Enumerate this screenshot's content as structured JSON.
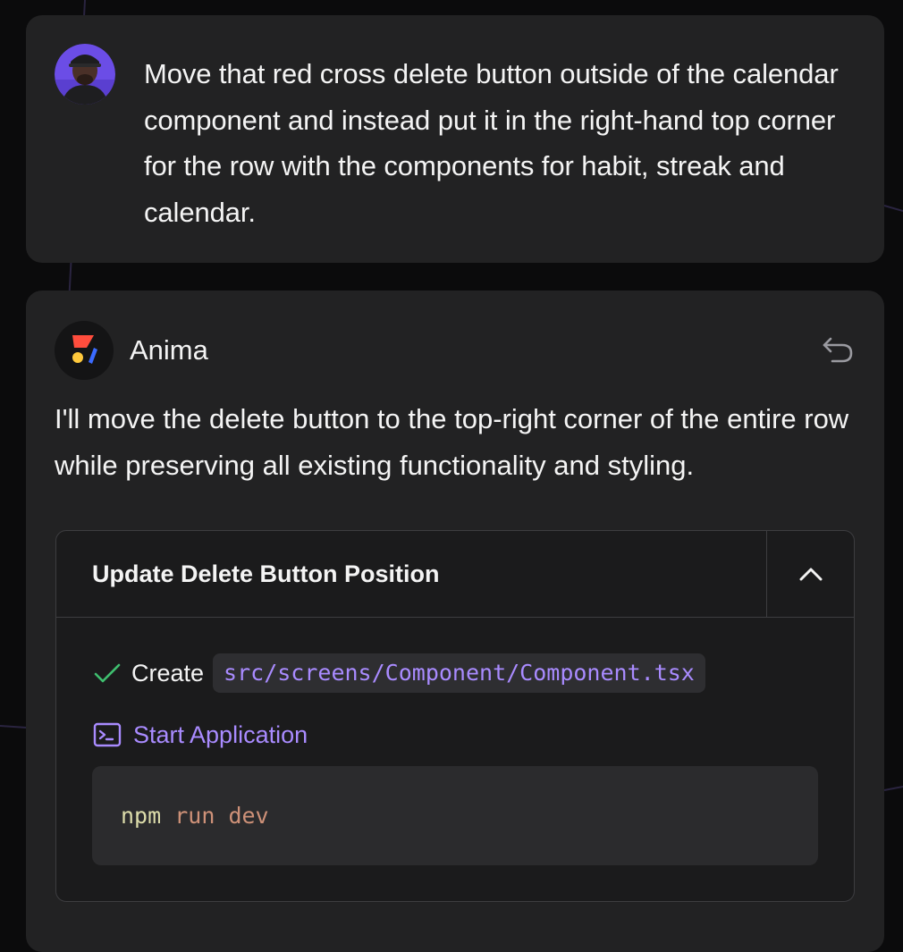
{
  "user_message": {
    "avatar_alt": "user-avatar",
    "text": "Move that red cross delete button outside of the calendar component and instead put it in the right-hand top corner for the row with the components for habit, streak and calendar."
  },
  "assistant": {
    "name": "Anima",
    "undo_icon": "undo-icon",
    "text": "I'll move the delete button to the top-right corner of the entire row while preserving all existing functionality and styling.",
    "task": {
      "title": "Update Delete Button Position",
      "collapse_icon": "chevron-up-icon",
      "steps": [
        {
          "status_icon": "check-icon",
          "action": "Create",
          "file": "src/screens/Component/Component.tsx"
        }
      ],
      "start": {
        "icon": "terminal-icon",
        "label": "Start Application"
      },
      "code": {
        "cmd": "npm",
        "args": [
          "run",
          "dev"
        ]
      }
    }
  },
  "colors": {
    "background": "#0b0b0c",
    "card": "#222223",
    "accent": "#a98bff",
    "check": "#3fbf6f",
    "code_cmd": "#dcdcaa",
    "code_arg": "#ce9178"
  }
}
